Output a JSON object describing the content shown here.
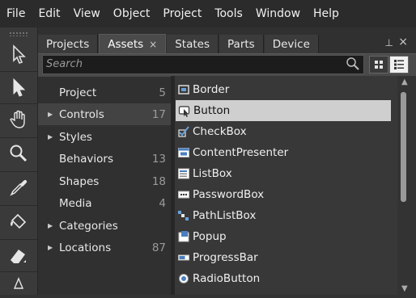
{
  "menu": [
    "File",
    "Edit",
    "View",
    "Object",
    "Project",
    "Tools",
    "Window",
    "Help"
  ],
  "tools": [
    {
      "name": "selection-arrow-icon"
    },
    {
      "name": "direct-selection-icon"
    },
    {
      "name": "pan-hand-icon"
    },
    {
      "name": "zoom-icon"
    },
    {
      "name": "eyedropper-icon"
    },
    {
      "name": "paint-bucket-icon"
    },
    {
      "name": "eraser-icon"
    }
  ],
  "tabs": [
    {
      "label": "Projects",
      "active": false
    },
    {
      "label": "Assets",
      "active": true,
      "close": "×"
    },
    {
      "label": "States",
      "active": false
    },
    {
      "label": "Parts",
      "active": false
    },
    {
      "label": "Device",
      "active": false
    }
  ],
  "panel_controls": {
    "pin": "⊥",
    "close": "×"
  },
  "search": {
    "placeholder": "Search"
  },
  "categories": [
    {
      "label": "Project",
      "count": "5",
      "arrow": ""
    },
    {
      "label": "Controls",
      "count": "17",
      "arrow": "▶",
      "selected": true
    },
    {
      "label": "Styles",
      "count": "",
      "arrow": "▶"
    },
    {
      "label": "Behaviors",
      "count": "13",
      "arrow": ""
    },
    {
      "label": "Shapes",
      "count": "18",
      "arrow": ""
    },
    {
      "label": "Media",
      "count": "4",
      "arrow": ""
    },
    {
      "label": "Categories",
      "count": "",
      "arrow": "▶"
    },
    {
      "label": "Locations",
      "count": "87",
      "arrow": "▶"
    }
  ],
  "assets": [
    {
      "label": "Border",
      "icon": "border-icon"
    },
    {
      "label": "Button",
      "icon": "button-icon",
      "selected": true
    },
    {
      "label": "CheckBox",
      "icon": "checkbox-icon"
    },
    {
      "label": "ContentPresenter",
      "icon": "content-presenter-icon"
    },
    {
      "label": "ListBox",
      "icon": "listbox-icon"
    },
    {
      "label": "PasswordBox",
      "icon": "passwordbox-icon"
    },
    {
      "label": "PathListBox",
      "icon": "pathlistbox-icon"
    },
    {
      "label": "Popup",
      "icon": "popup-icon"
    },
    {
      "label": "ProgressBar",
      "icon": "progressbar-icon"
    },
    {
      "label": "RadioButton",
      "icon": "radiobutton-icon"
    }
  ],
  "scroll": {
    "up": "▲",
    "down": "▼"
  }
}
